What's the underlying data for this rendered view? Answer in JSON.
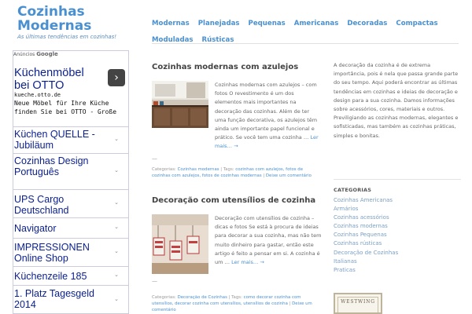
{
  "site": {
    "title_line1": "Cozinhas",
    "title_line2": "Modernas",
    "tagline": "As últimas tendências em cozinhas!"
  },
  "nav": {
    "items": [
      "Modernas",
      "Planejadas",
      "Pequenas",
      "Americanas",
      "Decoradas",
      "Compactas",
      "Moduladas",
      "Rústicas"
    ]
  },
  "ad": {
    "choices_label": "Anúncios",
    "choices_brand": "Google",
    "main_title": "Küchenmöbel bei OTTO",
    "domain": "kueche.otto.de",
    "description": "Neue Möbel für Ihre Küche finden Sie bei OTTO - Große Auswahl!",
    "arrow_icon": "chevron-right-icon",
    "links": [
      "Küchen QUELLE - Jubiläum",
      "Cozinhas Design Português",
      "UPS Cargo Deutschland",
      "Navigator",
      "IMPRESSIONEN Online Shop",
      "Küchenzeile 185",
      "1. Platz Tagesgeld 2014"
    ]
  },
  "posts": [
    {
      "title": "Cozinhas modernas com azulejos",
      "excerpt": "Cozinhas modernas com azulejos – com fotos O revestimento é um dos elementos mais importantes na decoração das cozinhas. Além de ter uma função decorativa, os azulejos têm ainda um importante papel funcional e prático. Se você tem uma cozinha … ",
      "more": "Ler mais… →",
      "dash": "—",
      "meta_prefix": "Categorias: ",
      "meta_category": "Cozinhas modernas",
      "meta_tags_label": " | Tags: ",
      "meta_tags": "cozinhas com azulejos, fotos de cozinhas com azulejos, fotos de cozinhas modernas",
      "meta_sep": " | ",
      "meta_comment": "Deixe um comentário"
    },
    {
      "title": "Decoração com utensílios de cozinha",
      "excerpt": "Decoração com utensílios de cozinha – dicas e fotos Se está à procura de ideias para decorar a sua cozinha, mas não tem muito dinheiro para gastar, então este artigo é feito a pensar em si. A cozinha é um … ",
      "more": "Ler mais… →",
      "dash": "—",
      "meta_prefix": "Categorias: ",
      "meta_category": "Decoração de Cozinhas",
      "meta_tags_label": " | Tags: ",
      "meta_tags": "como decorar cozinha com utensílios, decorar cozinha com utensílios, utensílios de cozinha",
      "meta_sep": " | ",
      "meta_comment": "Deixe um comentário"
    }
  ],
  "sidebar": {
    "about": "A decoração da cozinha é de extrema importância, pois é nela que passa grande parte do seu tempo. Aqui poderá encontrar as últimas tendências em cozinhas e ideias de decoração e design para a sua cozinha. Damos informações sobre acessórios, cores, materiais e outros. Previligiando as cozinhas modernas, elegantes e sofisticadas, mas também as cozinhas práticas, simples e bonitas.",
    "categories_heading": "CATEGORIAS",
    "categories": [
      "Cozinhas Americanas",
      "Armários",
      "Cozinhas acessórios",
      "Cozinhas modernas",
      "Cozinhas Pequenas",
      "Cozinhas rústicas",
      "Decoração de Cozinhas",
      "Italianas",
      "Praticas"
    ],
    "banner_text": "WESTWING"
  },
  "colors": {
    "accent": "#4a90d0",
    "ad_link": "#0a1f8f",
    "category_link": "#7a9fc4"
  }
}
